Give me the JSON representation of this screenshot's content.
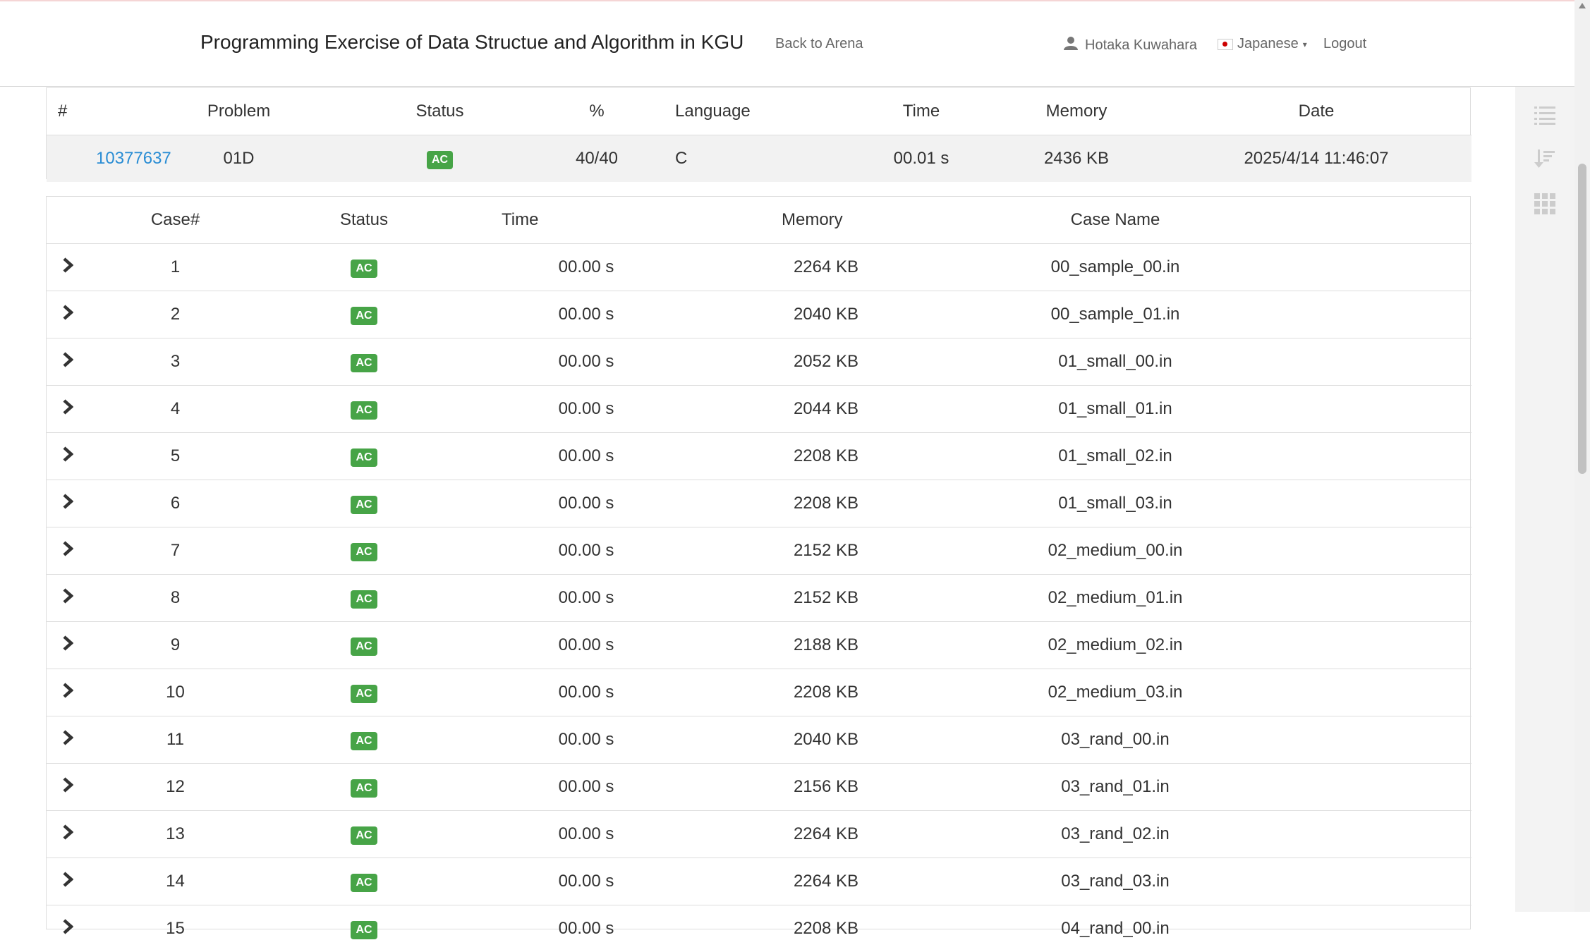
{
  "navbar": {
    "brand": "Programming Exercise of Data Structue and Algorithm in KGU",
    "back_link": "Back to Arena",
    "user_name": "Hotaka Kuwahara",
    "language": "Japanese",
    "logout": "Logout"
  },
  "summary": {
    "headers": [
      "#",
      "Problem",
      "Status",
      "%",
      "Language",
      "Time",
      "Memory",
      "Date"
    ],
    "row": {
      "id": "10377637",
      "problem": "01D",
      "status": "AC",
      "percent": "40/40",
      "language": "C",
      "time": "00.01 s",
      "memory": "2436 KB",
      "date": "2025/4/14 11:46:07"
    }
  },
  "cases": {
    "headers": [
      "Case#",
      "Status",
      "Time",
      "Memory",
      "Case Name"
    ],
    "rows": [
      {
        "num": "1",
        "status": "AC",
        "time": "00.00 s",
        "memory": "2264 KB",
        "name": "00_sample_00.in"
      },
      {
        "num": "2",
        "status": "AC",
        "time": "00.00 s",
        "memory": "2040 KB",
        "name": "00_sample_01.in"
      },
      {
        "num": "3",
        "status": "AC",
        "time": "00.00 s",
        "memory": "2052 KB",
        "name": "01_small_00.in"
      },
      {
        "num": "4",
        "status": "AC",
        "time": "00.00 s",
        "memory": "2044 KB",
        "name": "01_small_01.in"
      },
      {
        "num": "5",
        "status": "AC",
        "time": "00.00 s",
        "memory": "2208 KB",
        "name": "01_small_02.in"
      },
      {
        "num": "6",
        "status": "AC",
        "time": "00.00 s",
        "memory": "2208 KB",
        "name": "01_small_03.in"
      },
      {
        "num": "7",
        "status": "AC",
        "time": "00.00 s",
        "memory": "2152 KB",
        "name": "02_medium_00.in"
      },
      {
        "num": "8",
        "status": "AC",
        "time": "00.00 s",
        "memory": "2152 KB",
        "name": "02_medium_01.in"
      },
      {
        "num": "9",
        "status": "AC",
        "time": "00.00 s",
        "memory": "2188 KB",
        "name": "02_medium_02.in"
      },
      {
        "num": "10",
        "status": "AC",
        "time": "00.00 s",
        "memory": "2208 KB",
        "name": "02_medium_03.in"
      },
      {
        "num": "11",
        "status": "AC",
        "time": "00.00 s",
        "memory": "2040 KB",
        "name": "03_rand_00.in"
      },
      {
        "num": "12",
        "status": "AC",
        "time": "00.00 s",
        "memory": "2156 KB",
        "name": "03_rand_01.in"
      },
      {
        "num": "13",
        "status": "AC",
        "time": "00.00 s",
        "memory": "2264 KB",
        "name": "03_rand_02.in"
      },
      {
        "num": "14",
        "status": "AC",
        "time": "00.00 s",
        "memory": "2264 KB",
        "name": "03_rand_03.in"
      },
      {
        "num": "15",
        "status": "AC",
        "time": "00.00 s",
        "memory": "2208 KB",
        "name": "04_rand_00.in"
      }
    ]
  },
  "colors": {
    "accent_link": "#2a8dd4",
    "badge_ac": "#47a447"
  },
  "icons": {
    "rail": [
      "list-icon",
      "sort-icon",
      "grid-icon"
    ],
    "row_toggle": "chevron-right-icon",
    "user": "user-icon"
  }
}
